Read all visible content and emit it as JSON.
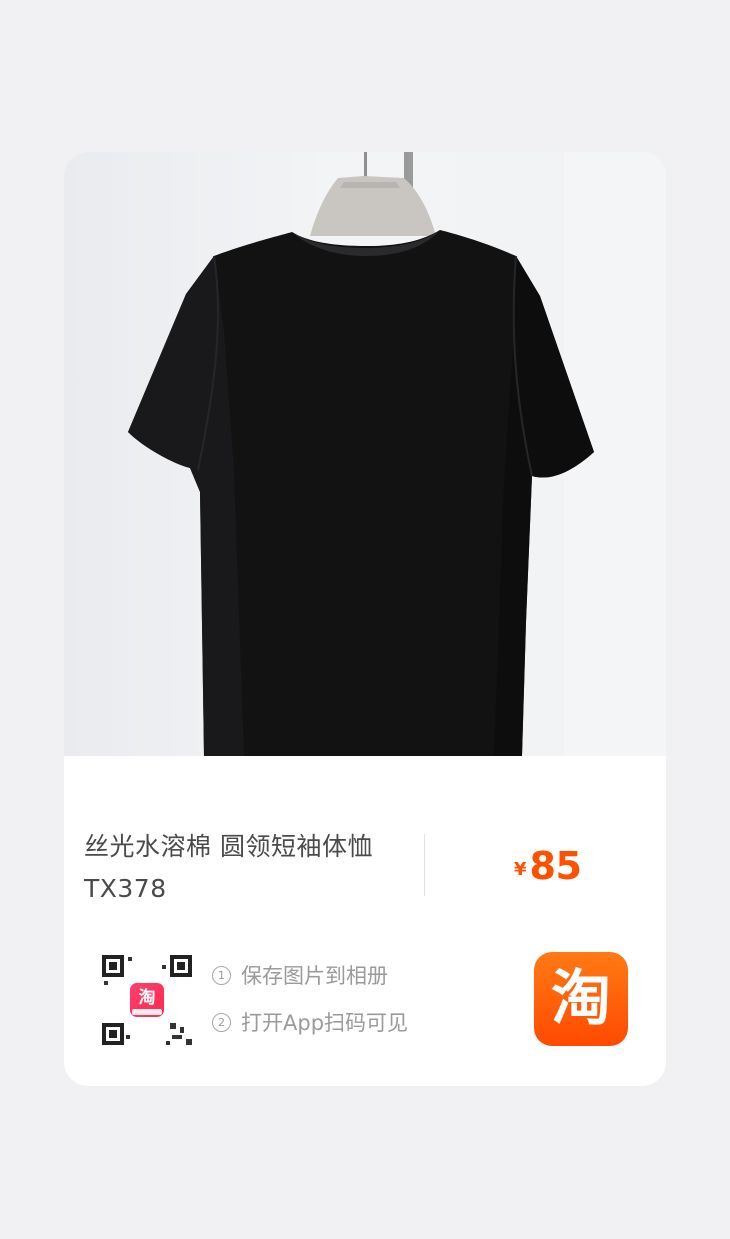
{
  "product": {
    "title_line1": "丝光水溶棉 圆领短袖体恤",
    "title_line2": "TX378",
    "price_currency": "¥",
    "price_value": "85"
  },
  "share": {
    "step1_number": "1",
    "step1_text": "保存图片到相册",
    "step2_number": "2",
    "step2_text": "打开App扫码可见",
    "qr_app_icon_char": "淘",
    "taobao_logo_char": "淘"
  },
  "colors": {
    "price": "#ff5000",
    "taobao_brand": "#ff5a00"
  }
}
